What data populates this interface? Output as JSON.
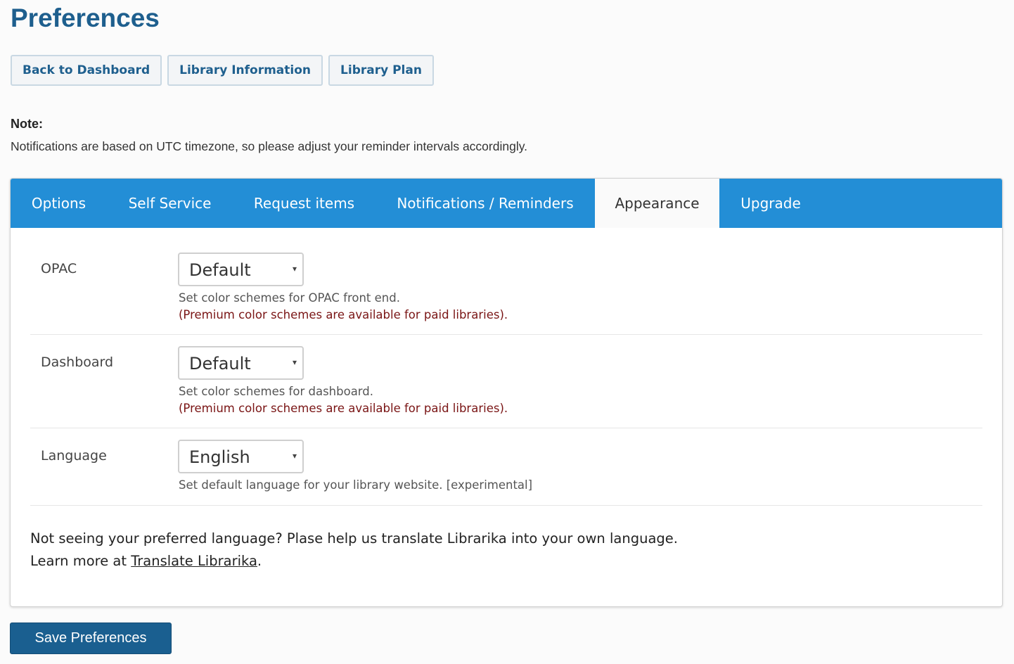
{
  "page": {
    "title": "Preferences"
  },
  "top_buttons": {
    "back": "Back to Dashboard",
    "library_info": "Library Information",
    "library_plan": "Library Plan"
  },
  "note": {
    "title": "Note:",
    "text": "Notifications are based on UTC timezone, so please adjust your reminder intervals accordingly."
  },
  "tabs": {
    "options": "Options",
    "self_service": "Self Service",
    "request_items": "Request items",
    "notifications": "Notifications / Reminders",
    "appearance": "Appearance",
    "upgrade": "Upgrade",
    "active": "Appearance"
  },
  "form": {
    "opac": {
      "label": "OPAC",
      "value": "Default",
      "help": "Set color schemes for OPAC front end.",
      "premium": "(Premium color schemes are available for paid libraries)."
    },
    "dashboard": {
      "label": "Dashboard",
      "value": "Default",
      "help": "Set color schemes for dashboard.",
      "premium": "(Premium color schemes are available for paid libraries)."
    },
    "language": {
      "label": "Language",
      "value": "English",
      "help": "Set default language for your library website. [experimental]"
    }
  },
  "footer": {
    "line1": "Not seeing your preferred language? Plase help us translate Librarika into your own language.",
    "line2_prefix": "Learn more at ",
    "link": "Translate Librarika",
    "line2_suffix": "."
  },
  "save_button": "Save Preferences",
  "colors": {
    "title_blue": "#1e5f8e",
    "tab_bar": "#238ed6",
    "save_button": "#1a5f90",
    "premium_text": "#7a1515"
  },
  "icons": {
    "select_caret": "▾"
  }
}
